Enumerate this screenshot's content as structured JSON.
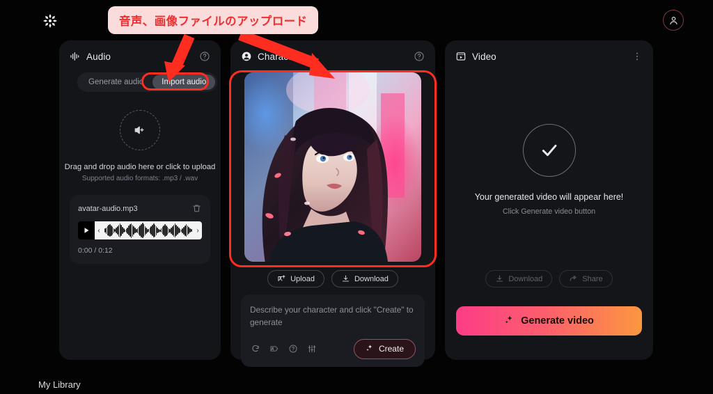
{
  "app": {
    "logo_icon": "snowflake-logo",
    "account_icon": "user-avatar-icon",
    "footer_label": "My Library"
  },
  "annotation": {
    "callout_text": "音声、画像ファイルのアップロード",
    "callout_bg": "#fbdcdc",
    "callout_color": "#ef2f2f",
    "highlight_color": "#ff2d20",
    "arrow_targets": [
      "import-audio-tab",
      "character-image"
    ]
  },
  "audio_panel": {
    "icon": "audio-waveform-icon",
    "title": "Audio",
    "help_icon": "help-circle-icon",
    "tabs": [
      {
        "label": "Generate audio",
        "selected": false
      },
      {
        "label": "Import audio",
        "selected": true
      }
    ],
    "dropzone": {
      "icon": "speaker-plus-icon",
      "primary": "Drag and drop audio here or click to upload",
      "secondary": "Supported audio formats: .mp3 / .wav"
    },
    "player": {
      "filename": "avatar-audio.mp3",
      "delete_icon": "trash-icon",
      "play_icon": "play-icon",
      "handle_left": "‹",
      "handle_right": "›",
      "time": "0:00 / 0:12",
      "current_time": "0:00",
      "duration": "0:12"
    }
  },
  "character_panel": {
    "icon": "person-circle-icon",
    "title": "Character",
    "help_icon": "help-circle-icon",
    "preview_alt": "anime portrait of a woman with dark hair against neon city lights",
    "actions": [
      {
        "label": "Upload",
        "icon": "image-upload-icon",
        "disabled": false
      },
      {
        "label": "Download",
        "icon": "download-icon",
        "disabled": false
      }
    ],
    "prompt": {
      "placeholder": "Describe your character and click \"Create\" to generate",
      "value": "",
      "tools": [
        {
          "icon": "refresh-icon"
        },
        {
          "icon": "image-tag-icon"
        },
        {
          "icon": "help-circle-icon"
        },
        {
          "icon": "sliders-icon"
        }
      ],
      "create_label": "Create",
      "create_icon": "sparkles-icon"
    }
  },
  "video_panel": {
    "icon": "video-frame-icon",
    "title": "Video",
    "menu_icon": "more-vertical-icon",
    "placeholder": {
      "icon": "check-circle-icon",
      "primary": "Your generated video will appear here!",
      "secondary": "Click Generate video button"
    },
    "actions": [
      {
        "label": "Download",
        "icon": "download-icon",
        "disabled": true
      },
      {
        "label": "Share",
        "icon": "share-icon",
        "disabled": true
      }
    ],
    "generate": {
      "label": "Generate video",
      "icon": "sparkles-icon",
      "gradient_from": "#fc3d86",
      "gradient_to": "#fb9740"
    }
  }
}
